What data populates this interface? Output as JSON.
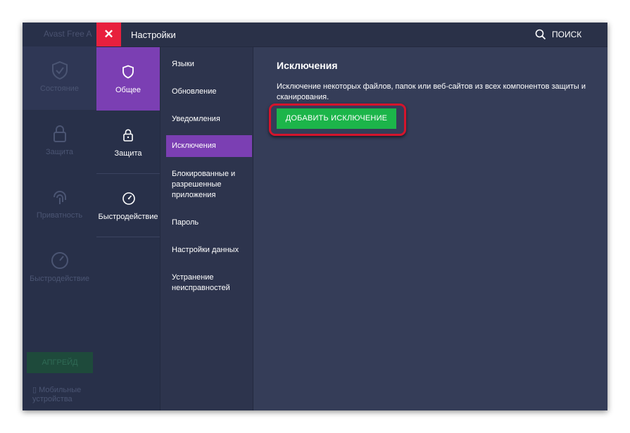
{
  "background_app": {
    "title": "Avast Free A",
    "nav": [
      {
        "label": "Состояние",
        "icon": "shield-check-icon"
      },
      {
        "label": "Защита",
        "icon": "lock-icon"
      },
      {
        "label": "Приватность",
        "icon": "fingerprint-icon"
      },
      {
        "label": "Быстродействие",
        "icon": "speedometer-icon"
      }
    ],
    "upgrade_label": "АПГРЕЙД",
    "mobile_label_1": "Мобильные",
    "mobile_label_2": "устройства"
  },
  "topbar": {
    "close_glyph": "✕",
    "title": "Настройки",
    "search_label": "ПОИСК",
    "close_color": "#e8203d"
  },
  "categories": [
    {
      "label": "Общее",
      "icon": "shield-icon",
      "active": true
    },
    {
      "label": "Защита",
      "icon": "lock-icon",
      "active": false
    },
    {
      "label": "Быстродействие",
      "icon": "speedometer-icon",
      "active": false
    }
  ],
  "submenu": {
    "items": [
      {
        "label": "Языки"
      },
      {
        "label": "Обновление"
      },
      {
        "label": "Уведомления"
      },
      {
        "label": "Исключения",
        "active": true
      },
      {
        "label_lines": [
          "Блокированные и",
          "разрешенные",
          "приложения"
        ]
      },
      {
        "label": "Пароль"
      },
      {
        "label": "Настройки данных"
      },
      {
        "label_lines": [
          "Устранение",
          "неисправностей"
        ]
      }
    ]
  },
  "content": {
    "title": "Исключения",
    "description": "Исключение некоторых файлов, папок или веб-сайтов из всех компонентов защиты и сканирования.",
    "add_button_label": "ДОБАВИТЬ ИСКЛЮЧЕНИЕ"
  },
  "colors": {
    "accent_purple": "#7b3fb3",
    "button_green": "#1cb54a",
    "highlight_red": "#d5142c",
    "panel_dark": "#353d58"
  }
}
